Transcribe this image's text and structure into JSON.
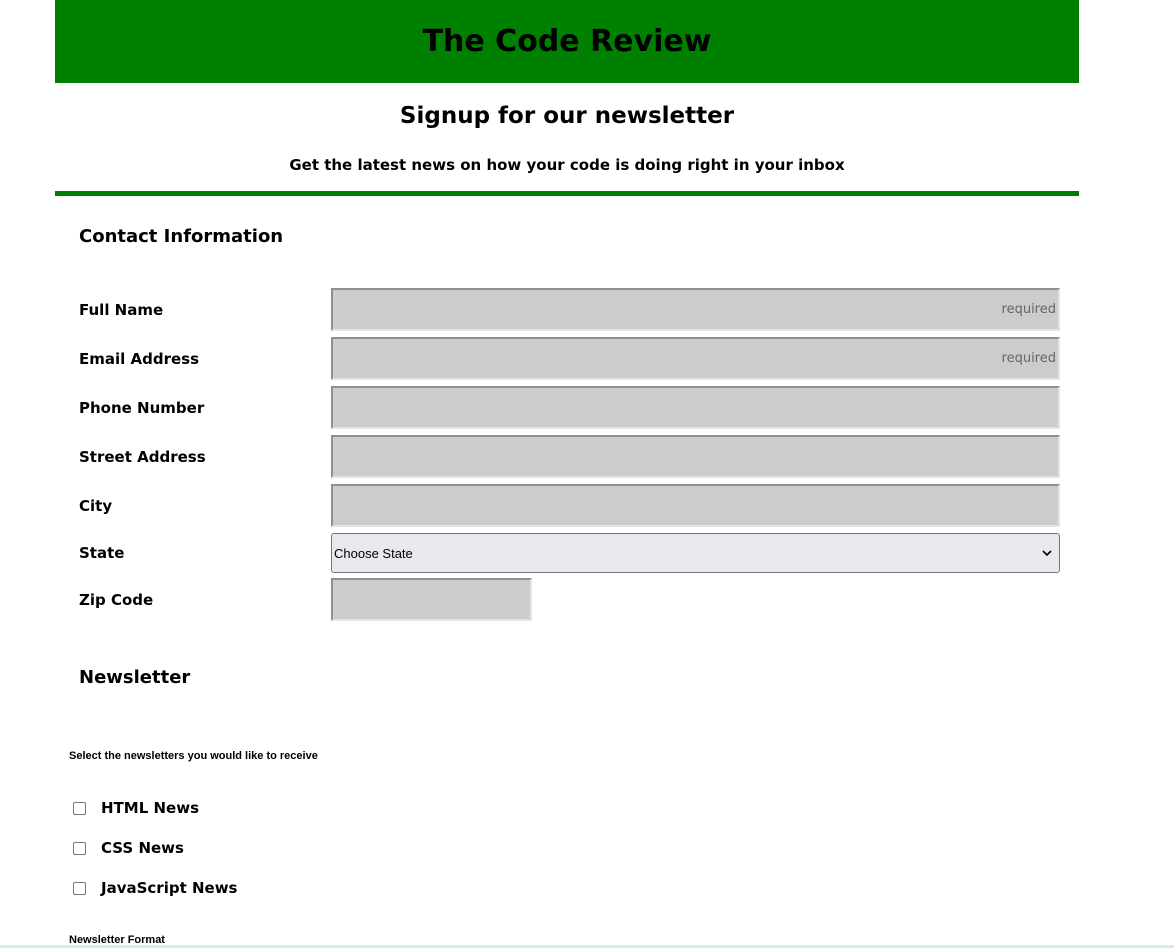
{
  "header": {
    "title": "The Code Review"
  },
  "intro": {
    "title": "Signup for our newsletter",
    "tagline": "Get the latest news on how your code is doing right in your inbox"
  },
  "contact": {
    "section_title": "Contact Information",
    "full_name": {
      "label": "Full Name",
      "value": "",
      "placeholder": "required"
    },
    "email": {
      "label": "Email Address",
      "value": "",
      "placeholder": "required"
    },
    "phone": {
      "label": "Phone Number",
      "value": "",
      "placeholder": ""
    },
    "street": {
      "label": "Street Address",
      "value": "",
      "placeholder": ""
    },
    "city": {
      "label": "City",
      "value": "",
      "placeholder": ""
    },
    "state": {
      "label": "State",
      "selected": "Choose State"
    },
    "zip": {
      "label": "Zip Code",
      "value": "",
      "placeholder": ""
    }
  },
  "newsletter": {
    "section_title": "Newsletter",
    "instructions": "Select the newsletters you would like to receive",
    "options": [
      {
        "label": "HTML News",
        "checked": false
      },
      {
        "label": "CSS News",
        "checked": false
      },
      {
        "label": "JavaScript News",
        "checked": false
      }
    ],
    "format_label": "Newsletter Format"
  },
  "colors": {
    "brand": "#008000",
    "field_bg": "#cccccc",
    "select_bg": "#e8e8ed"
  },
  "icons": {
    "select_arrow": "chevron-down-icon"
  }
}
